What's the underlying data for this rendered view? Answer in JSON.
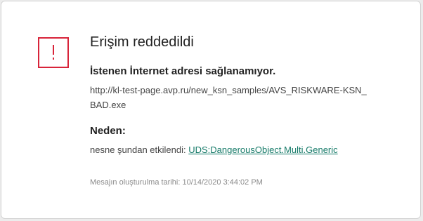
{
  "alert": {
    "icon": "exclamation-icon",
    "accent_color": "#d8243a",
    "title": "Erişim reddedildi",
    "headline": "İstenen İnternet adresi sağlanamıyor.",
    "url": "http://kl-test-page.avp.ru/new_ksn_samples/AVS_RISKWARE-KSN_BAD.exe"
  },
  "reason": {
    "heading": "Neden:",
    "prefix": "nesne şundan etkilendi:",
    "threat_name": "UDS:DangerousObject.Multi.Generic",
    "link_color": "#157a68"
  },
  "footer": {
    "created_label": "Mesajın oluşturulma tarihi:",
    "created_time": "10/14/2020 3:44:02 PM"
  }
}
